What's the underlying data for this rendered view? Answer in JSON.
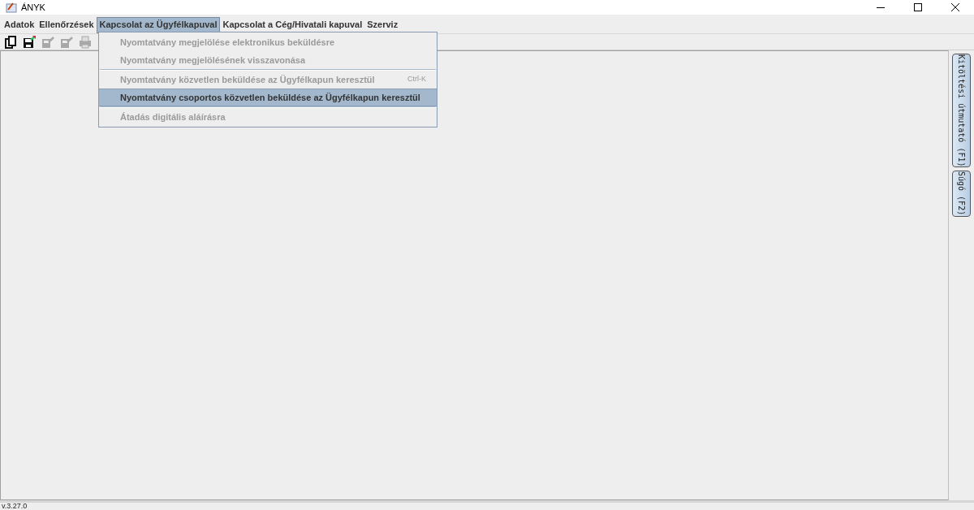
{
  "window": {
    "title": "ÁNYK"
  },
  "menu": [
    {
      "label": "Adatok",
      "selected": false
    },
    {
      "label": "Ellenőrzések",
      "selected": false
    },
    {
      "label": "Kapcsolat az Ügyfélkapuval",
      "selected": true
    },
    {
      "label": "Kapcsolat a Cég/Hivatali kapuval",
      "selected": false
    },
    {
      "label": "Szerviz",
      "selected": false
    }
  ],
  "toolbar": [
    {
      "kind": "copy",
      "disabled": false
    },
    {
      "kind": "save",
      "disabled": false
    },
    {
      "kind": "edit",
      "disabled": true
    },
    {
      "kind": "edit",
      "disabled": true
    },
    {
      "kind": "print",
      "disabled": true
    }
  ],
  "dropdown": [
    {
      "label": "Nyomtatvány megjelölése elektronikus beküldésre",
      "disabled": true,
      "selected": false,
      "separator_before": false
    },
    {
      "label": "Nyomtatvány megjelölésének visszavonása",
      "disabled": true,
      "selected": false,
      "separator_before": false
    },
    {
      "label": "Nyomtatvány közvetlen beküldése az Ügyfélkapun keresztül",
      "disabled": true,
      "selected": false,
      "separator_before": true,
      "shortcut": "Ctrl-K"
    },
    {
      "label": "Nyomtatvány csoportos közvetlen beküldése az Ügyfélkapun keresztül",
      "disabled": false,
      "selected": true,
      "separator_before": false
    },
    {
      "label": "Átadás digitális aláírásra",
      "disabled": true,
      "selected": false,
      "separator_before": true
    }
  ],
  "side_tabs": [
    "Kitöltési útmutató (F1)",
    "Súgó (F2)"
  ],
  "status_bar": "v.3.27.0"
}
